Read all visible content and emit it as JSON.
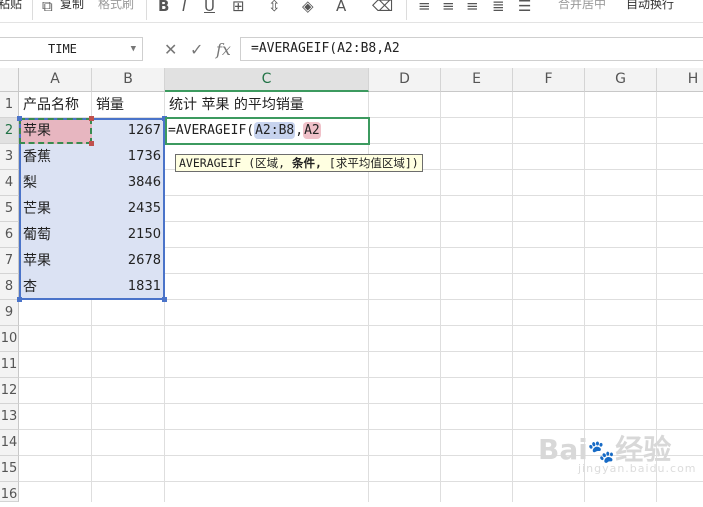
{
  "ribbon": {
    "paste_label": "粘贴",
    "copy_label": "复制",
    "format_painter_label": "格式刷",
    "merge_center_label": "合并居中",
    "wrap_text_label": "自动换行"
  },
  "formula_bar": {
    "name_box": "TIME",
    "fx_label": "fx",
    "formula": "=AVERAGEIF(A2:B8,A2"
  },
  "columns": [
    "A",
    "B",
    "C",
    "D",
    "E",
    "F",
    "G",
    "H"
  ],
  "rows": [
    "1",
    "2",
    "3",
    "4",
    "5",
    "6",
    "7",
    "8",
    "9",
    "10",
    "11",
    "12",
    "13",
    "14",
    "15",
    "16"
  ],
  "cells": {
    "A1": "产品名称",
    "B1": "销量",
    "C1": "统计 苹果 的平均销量",
    "A2": "苹果",
    "B2": "1267",
    "A3": "香蕉",
    "B3": "1736",
    "A4": "梨",
    "B4": "3846",
    "A5": "芒果",
    "B5": "2435",
    "A6": "葡萄",
    "B6": "2150",
    "A7": "苹果",
    "B7": "2678",
    "A8": "杏",
    "B8": "1831"
  },
  "edit_cell": {
    "prefix": "=AVERAGEIF(",
    "ref_range": "A2:B8",
    "comma": ",",
    "ref_criteria": "A2"
  },
  "tooltip": {
    "func": "AVERAGEIF",
    "open": " (",
    "arg1": "区域,",
    "arg2": " 条件,",
    "arg3": " [求平均值区域])"
  },
  "watermark": {
    "brand": "Bai",
    "paw": "🐾",
    "brand2": "经验",
    "sub": "jingyan.baidu.com"
  },
  "colors": {
    "selection_green": "#3c9a5f",
    "range_blue": "#4a73c9",
    "range_fill": "#dbe2f3",
    "criteria_fill": "#e7b6c0"
  }
}
